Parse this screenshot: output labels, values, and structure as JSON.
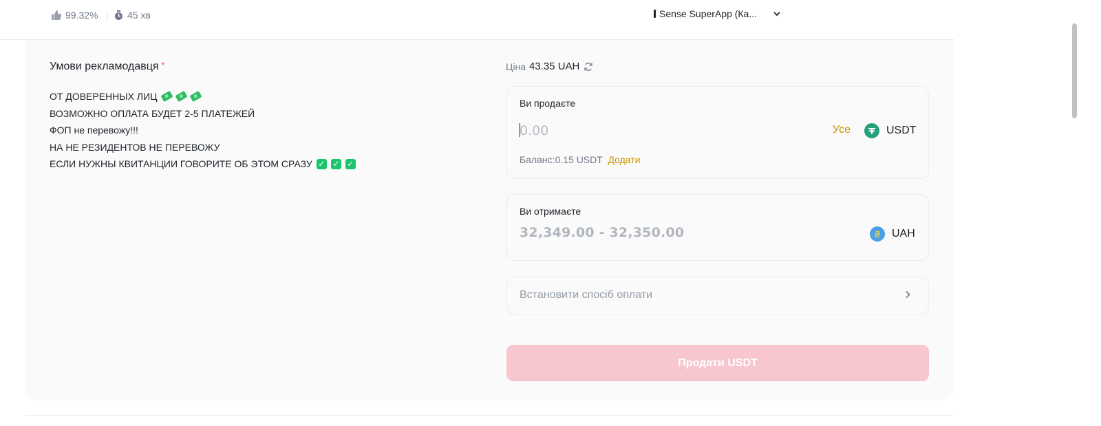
{
  "header": {
    "completion_rate": "99.32%",
    "avg_time": "45 хв",
    "payment_method": "Sense SuperApp (Ка..."
  },
  "terms": {
    "title": "Умови рекламодавця",
    "required_mark": "*",
    "lines": [
      "ОТ ДОВЕРЕННЫХ ЛИЦ",
      "ВОЗМОЖНО ОПЛАТА БУДЕТ 2-5 ПЛАТЕЖЕЙ",
      "ФОП не перевожу!!!",
      "НА НЕ РЕЗИДЕНТОВ НЕ ПЕРЕВОЖУ",
      "ЕСЛИ НУЖНЫ КВИТАНЦИИ ГОВОРИТЕ ОБ ЭТОМ СРАЗУ"
    ]
  },
  "price": {
    "label": "Ціна",
    "value": "43.35 UAH"
  },
  "sell": {
    "label": "Ви продаєте",
    "placeholder": "0.00",
    "all_label": "Усе",
    "currency": "USDT",
    "balance_label": "Баланс:",
    "balance_value": "0.15 USDT",
    "add_label": "Додати"
  },
  "receive": {
    "label": "Ви отримаєте",
    "range": "32,349.00 - 32,350.00",
    "currency": "UAH"
  },
  "method": {
    "label": "Встановити спосіб оплати"
  },
  "submit": {
    "label": "Продати USDT"
  },
  "colors": {
    "accent": "#c99400",
    "submit_disabled": "#f7c6ce",
    "usdt": "#26a17b",
    "uah": "#4a9fea"
  }
}
